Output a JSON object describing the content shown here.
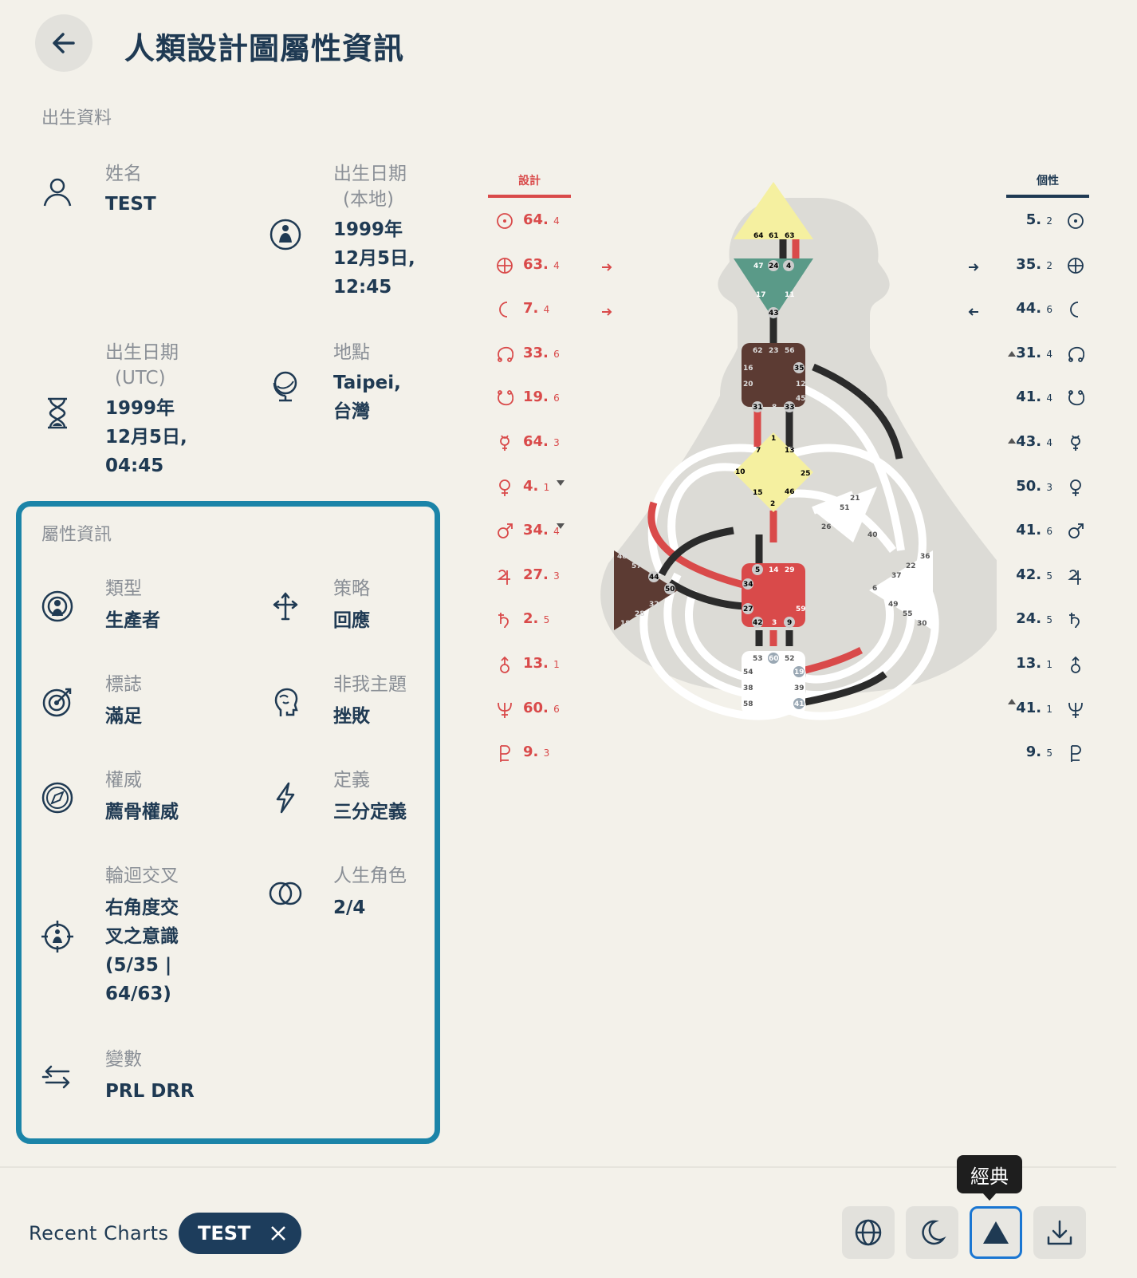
{
  "header": {
    "title": "人類設計圖屬性資訊"
  },
  "birth": {
    "section": "出生資料",
    "name": {
      "label": "姓名",
      "value": "TEST"
    },
    "local_date": {
      "label1": "出生日期",
      "label2": "(本地)",
      "v1": "1999年",
      "v2": "12月5日,",
      "v3": "12:45"
    },
    "utc_date": {
      "label1": "出生日期",
      "label2": "(UTC)",
      "v1": "1999年",
      "v2": "12月5日,",
      "v3": "04:45"
    },
    "place": {
      "label": "地點",
      "v1": "Taipei,",
      "v2": "台灣"
    }
  },
  "attributes": {
    "section": "屬性資訊",
    "type": {
      "label": "類型",
      "value": "生產者"
    },
    "strategy": {
      "label": "策略",
      "value": "回應"
    },
    "signature": {
      "label": "標誌",
      "value": "滿足"
    },
    "not_self": {
      "label": "非我主題",
      "value": "挫敗"
    },
    "authority": {
      "label": "權威",
      "value": "薦骨權威"
    },
    "definition": {
      "label": "定義",
      "value": "三分定義"
    },
    "cross": {
      "label": "輪迴交叉",
      "v1": "右角度交",
      "v2": "叉之意識",
      "v3": "(5/35 |",
      "v4": "64/63)"
    },
    "profile": {
      "label": "人生角色",
      "value": "2/4"
    },
    "variable": {
      "label": "變數",
      "value": "PRL DRR"
    }
  },
  "chart": {
    "design_header": "設計",
    "personality_header": "個性",
    "design": [
      {
        "gate": "64.",
        "line": "4",
        "symbol": "sun-icon"
      },
      {
        "gate": "63.",
        "line": "4",
        "symbol": "earth-icon"
      },
      {
        "gate": "7.",
        "line": "4",
        "symbol": "moon-icon"
      },
      {
        "gate": "33.",
        "line": "6",
        "symbol": "north-node-icon"
      },
      {
        "gate": "19.",
        "line": "6",
        "symbol": "south-node-icon"
      },
      {
        "gate": "64.",
        "line": "3",
        "symbol": "mercury-icon"
      },
      {
        "gate": "4.",
        "line": "1",
        "symbol": "venus-icon"
      },
      {
        "gate": "34.",
        "line": "4",
        "symbol": "mars-icon"
      },
      {
        "gate": "27.",
        "line": "3",
        "symbol": "jupiter-icon"
      },
      {
        "gate": "2.",
        "line": "5",
        "symbol": "saturn-icon"
      },
      {
        "gate": "13.",
        "line": "1",
        "symbol": "uranus-icon"
      },
      {
        "gate": "60.",
        "line": "6",
        "symbol": "neptune-icon"
      },
      {
        "gate": "9.",
        "line": "3",
        "symbol": "pluto-icon"
      }
    ],
    "personality": [
      {
        "gate": "5.",
        "line": "2",
        "symbol": "sun-icon"
      },
      {
        "gate": "35.",
        "line": "2",
        "symbol": "earth-icon"
      },
      {
        "gate": "44.",
        "line": "6",
        "symbol": "moon-icon"
      },
      {
        "gate": "31.",
        "line": "4",
        "symbol": "north-node-icon"
      },
      {
        "gate": "41.",
        "line": "4",
        "symbol": "south-node-icon"
      },
      {
        "gate": "43.",
        "line": "4",
        "symbol": "mercury-icon"
      },
      {
        "gate": "50.",
        "line": "3",
        "symbol": "venus-icon"
      },
      {
        "gate": "41.",
        "line": "6",
        "symbol": "mars-icon"
      },
      {
        "gate": "42.",
        "line": "5",
        "symbol": "jupiter-icon"
      },
      {
        "gate": "24.",
        "line": "5",
        "symbol": "saturn-icon"
      },
      {
        "gate": "13.",
        "line": "1",
        "symbol": "uranus-icon"
      },
      {
        "gate": "41.",
        "line": "1",
        "symbol": "neptune-icon"
      },
      {
        "gate": "9.",
        "line": "5",
        "symbol": "pluto-icon"
      }
    ],
    "centers": {
      "head": [
        "64",
        "61",
        "63"
      ],
      "ajna": [
        "47",
        "24",
        "4",
        "17",
        "11",
        "43"
      ],
      "throat": [
        "62",
        "23",
        "56",
        "16",
        "35",
        "20",
        "12",
        "45",
        "31",
        "8",
        "33"
      ],
      "g": [
        "1",
        "7",
        "13",
        "10",
        "25",
        "15",
        "46",
        "2"
      ],
      "ego": [
        "21",
        "51",
        "26",
        "40"
      ],
      "sacral": [
        "5",
        "14",
        "29",
        "34",
        "27",
        "59",
        "42",
        "3",
        "9"
      ],
      "spleen": [
        "48",
        "57",
        "44",
        "50",
        "32",
        "28",
        "18"
      ],
      "solar_plexus": [
        "36",
        "22",
        "37",
        "6",
        "49",
        "55",
        "30"
      ],
      "root": [
        "53",
        "60",
        "52",
        "54",
        "19",
        "38",
        "39",
        "58",
        "41"
      ]
    },
    "colors": {
      "design": "#d94a4a",
      "personality": "#2b2b2b",
      "head": "#f5f0a0",
      "ajna": "#5a9a88",
      "throat": "#5c3b33",
      "g": "#f5f0a0",
      "sacral": "#d94a4a",
      "spleen": "#5c3b33",
      "undefined": "#ffffff",
      "body": "#dcdbd6"
    }
  },
  "bottom": {
    "recent_label": "Recent Charts",
    "chip_label": "TEST",
    "tooltip": "經典"
  }
}
